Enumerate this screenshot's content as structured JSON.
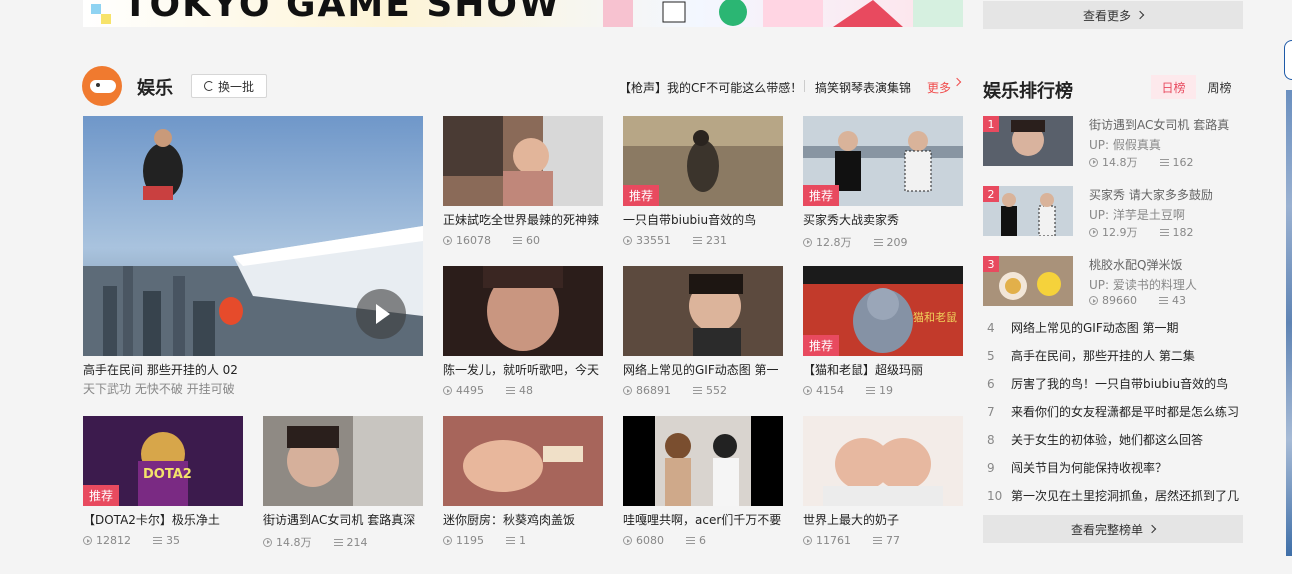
{
  "top": {
    "more_label": "查看更多"
  },
  "section": {
    "title": "娱乐",
    "refresh_label": "换一批",
    "hot_links": [
      "【枪声】我的CF不可能这么带感！",
      "搞笑钢琴表演集锦"
    ],
    "more_label": "更多"
  },
  "featured": {
    "title": "高手在民间 那些开挂的人 02",
    "subtitle": "天下武功 无快不破 开挂可破"
  },
  "videos": [
    {
      "title": "正妹試吃全世界最辣的死神辣",
      "plays": "16078",
      "comments": "60",
      "tag": ""
    },
    {
      "title": "一只自带biubiu音效的鸟",
      "plays": "33551",
      "comments": "231",
      "tag": "推荐"
    },
    {
      "title": "买家秀大战卖家秀",
      "plays": "12.8万",
      "comments": "209",
      "tag": "推荐"
    },
    {
      "title": "陈一发儿，就听听歌吧，今天",
      "plays": "4495",
      "comments": "48",
      "tag": ""
    },
    {
      "title": "网络上常见的GIF动态图 第一",
      "plays": "86891",
      "comments": "552",
      "tag": ""
    },
    {
      "title": "【猫和老鼠】超级玛丽",
      "plays": "4154",
      "comments": "19",
      "tag": "推荐"
    },
    {
      "title": "【DOTA2卡尔】极乐净土",
      "plays": "12812",
      "comments": "35",
      "tag": "推荐"
    },
    {
      "title": "街访遇到AC女司机 套路真深",
      "plays": "14.8万",
      "comments": "214",
      "tag": ""
    },
    {
      "title": "迷你厨房：秋葵鸡肉盖饭",
      "plays": "1195",
      "comments": "1",
      "tag": ""
    },
    {
      "title": "哇嘎哩共啊，acer们千万不要",
      "plays": "6080",
      "comments": "6",
      "tag": ""
    },
    {
      "title": "世界上最大的奶子",
      "plays": "11761",
      "comments": "77",
      "tag": ""
    }
  ],
  "thumb_texts": {
    "dota": "DOTA2",
    "tom": "猫和老鼠"
  },
  "ranking": {
    "title": "娱乐排行榜",
    "tab_daily": "日榜",
    "tab_weekly": "周榜",
    "top": [
      {
        "num": "1",
        "title": "街访遇到AC女司机 套路真",
        "uploader": "UP: 假假真真",
        "plays": "14.8万",
        "comments": "162"
      },
      {
        "num": "2",
        "title": "买家秀 请大家多多鼓励",
        "uploader": "UP: 洋芋是土豆啊",
        "plays": "12.9万",
        "comments": "182"
      },
      {
        "num": "3",
        "title": "桃胶水配Q弹米饭",
        "uploader": "UP: 爱读书的料理人",
        "plays": "89660",
        "comments": "43"
      }
    ],
    "list": [
      {
        "num": "4",
        "title": "网络上常见的GIF动态图 第一期"
      },
      {
        "num": "5",
        "title": "高手在民间，那些开挂的人 第二集"
      },
      {
        "num": "6",
        "title": "厉害了我的鸟！一只自带biubiu音效的鸟"
      },
      {
        "num": "7",
        "title": "来看你们的女友程潇都是平时都是怎么练习"
      },
      {
        "num": "8",
        "title": "关于女生的初体验，她们都这么回答"
      },
      {
        "num": "9",
        "title": "闯关节目为何能保持收视率？"
      },
      {
        "num": "10",
        "title": "第一次见在土里挖洞抓鱼，居然还抓到了几"
      }
    ],
    "full_label": "查看完整榜单"
  }
}
